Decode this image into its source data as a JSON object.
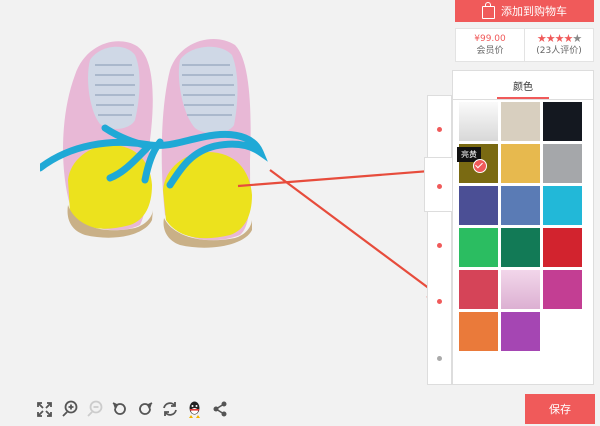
{
  "cart": {
    "label": "添加到购物车"
  },
  "pricing": {
    "price": "¥99.00",
    "price_caption": "会员价",
    "rating_stars": 4,
    "rating_max": 5,
    "reviews": "(23人评价)"
  },
  "panel": {
    "title": "颜色",
    "selected_tooltip": "亮黄"
  },
  "swatches": [
    {
      "name": "white",
      "color": "#e9e9e9"
    },
    {
      "name": "beige",
      "color": "#d8cfbf"
    },
    {
      "name": "black",
      "color": "#141820"
    },
    {
      "name": "olive",
      "color": "#7a6a12"
    },
    {
      "name": "gold",
      "color": "#e7b94e"
    },
    {
      "name": "gray",
      "color": "#a5a7aa"
    },
    {
      "name": "indigo",
      "color": "#4b4f95"
    },
    {
      "name": "steel-blue",
      "color": "#5a7bb5"
    },
    {
      "name": "cyan",
      "color": "#22b8d8"
    },
    {
      "name": "green",
      "color": "#2bbd61"
    },
    {
      "name": "dark-green",
      "color": "#127a56"
    },
    {
      "name": "red",
      "color": "#d2232e"
    },
    {
      "name": "rose",
      "color": "#d54458"
    },
    {
      "name": "light-pink",
      "color": "#e8c4de"
    },
    {
      "name": "magenta",
      "color": "#c33e93"
    },
    {
      "name": "orange",
      "color": "#ea7a3a"
    },
    {
      "name": "purple",
      "color": "#a546b3"
    }
  ],
  "toolbar": {
    "icons": [
      "fullscreen-icon",
      "zoom-in-icon",
      "zoom-out-icon",
      "rotate-left-icon",
      "undo-icon",
      "refresh-icon",
      "qq-icon",
      "share-icon"
    ]
  },
  "save": {
    "label": "保存"
  },
  "colors": {
    "accent": "#f05a5a"
  }
}
